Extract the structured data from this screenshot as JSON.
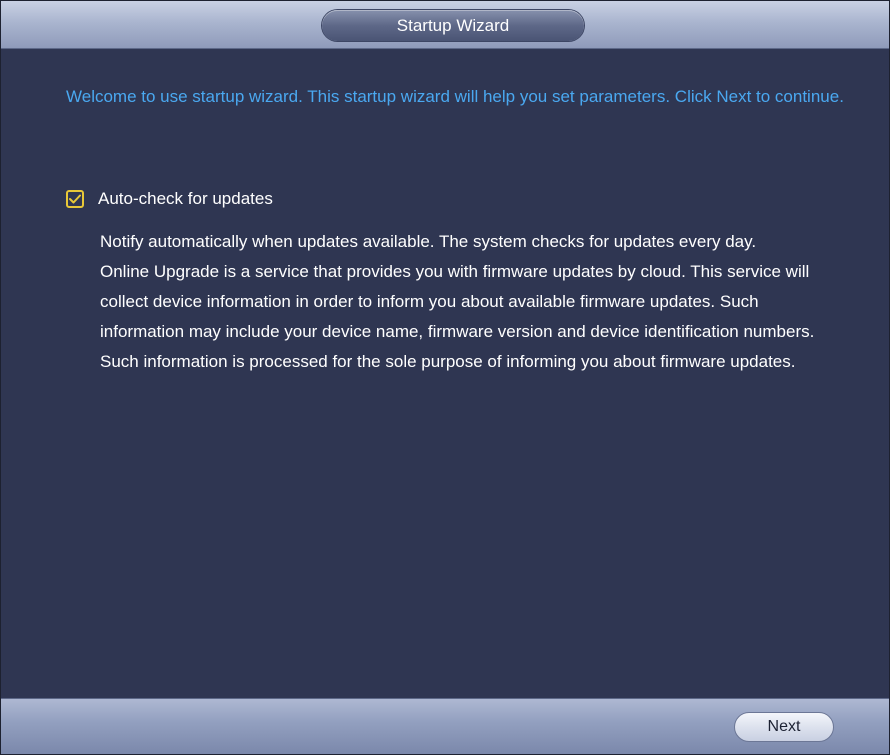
{
  "window": {
    "title": "Startup Wizard"
  },
  "main": {
    "welcome_text": "Welcome to use startup wizard. This startup wizard will help you set parameters. Click Next to continue.",
    "auto_check": {
      "label": "Auto-check for updates",
      "checked": true,
      "description_1": "Notify automatically when updates available. The system checks for updates every day.",
      "description_2": "Online Upgrade is a service that provides you with firmware updates by cloud. This service will collect device information in order to inform you about available firmware updates. Such information may include your device name, firmware version and device identification numbers. Such information is processed for the sole purpose of informing you about firmware updates."
    }
  },
  "footer": {
    "next_label": "Next"
  },
  "icons": {
    "checkbox": "checkmark-icon"
  },
  "colors": {
    "background": "#2f3652",
    "welcome_text": "#4aa8f0",
    "checkbox_accent": "#e8c838"
  }
}
